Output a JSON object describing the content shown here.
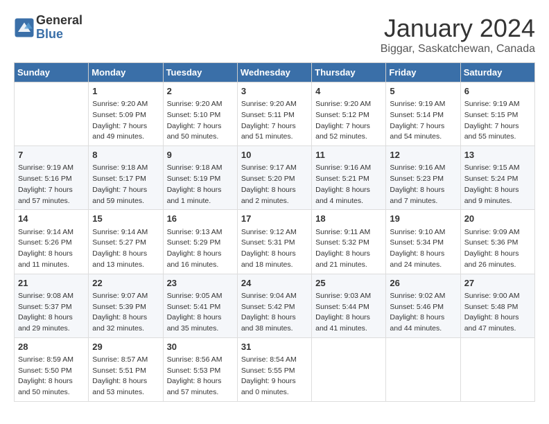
{
  "logo": {
    "general": "General",
    "blue": "Blue"
  },
  "header": {
    "month": "January 2024",
    "location": "Biggar, Saskatchewan, Canada"
  },
  "weekdays": [
    "Sunday",
    "Monday",
    "Tuesday",
    "Wednesday",
    "Thursday",
    "Friday",
    "Saturday"
  ],
  "weeks": [
    [
      {
        "day": "",
        "info": ""
      },
      {
        "day": "1",
        "info": "Sunrise: 9:20 AM\nSunset: 5:09 PM\nDaylight: 7 hours\nand 49 minutes."
      },
      {
        "day": "2",
        "info": "Sunrise: 9:20 AM\nSunset: 5:10 PM\nDaylight: 7 hours\nand 50 minutes."
      },
      {
        "day": "3",
        "info": "Sunrise: 9:20 AM\nSunset: 5:11 PM\nDaylight: 7 hours\nand 51 minutes."
      },
      {
        "day": "4",
        "info": "Sunrise: 9:20 AM\nSunset: 5:12 PM\nDaylight: 7 hours\nand 52 minutes."
      },
      {
        "day": "5",
        "info": "Sunrise: 9:19 AM\nSunset: 5:14 PM\nDaylight: 7 hours\nand 54 minutes."
      },
      {
        "day": "6",
        "info": "Sunrise: 9:19 AM\nSunset: 5:15 PM\nDaylight: 7 hours\nand 55 minutes."
      }
    ],
    [
      {
        "day": "7",
        "info": "Sunrise: 9:19 AM\nSunset: 5:16 PM\nDaylight: 7 hours\nand 57 minutes."
      },
      {
        "day": "8",
        "info": "Sunrise: 9:18 AM\nSunset: 5:17 PM\nDaylight: 7 hours\nand 59 minutes."
      },
      {
        "day": "9",
        "info": "Sunrise: 9:18 AM\nSunset: 5:19 PM\nDaylight: 8 hours\nand 1 minute."
      },
      {
        "day": "10",
        "info": "Sunrise: 9:17 AM\nSunset: 5:20 PM\nDaylight: 8 hours\nand 2 minutes."
      },
      {
        "day": "11",
        "info": "Sunrise: 9:16 AM\nSunset: 5:21 PM\nDaylight: 8 hours\nand 4 minutes."
      },
      {
        "day": "12",
        "info": "Sunrise: 9:16 AM\nSunset: 5:23 PM\nDaylight: 8 hours\nand 7 minutes."
      },
      {
        "day": "13",
        "info": "Sunrise: 9:15 AM\nSunset: 5:24 PM\nDaylight: 8 hours\nand 9 minutes."
      }
    ],
    [
      {
        "day": "14",
        "info": "Sunrise: 9:14 AM\nSunset: 5:26 PM\nDaylight: 8 hours\nand 11 minutes."
      },
      {
        "day": "15",
        "info": "Sunrise: 9:14 AM\nSunset: 5:27 PM\nDaylight: 8 hours\nand 13 minutes."
      },
      {
        "day": "16",
        "info": "Sunrise: 9:13 AM\nSunset: 5:29 PM\nDaylight: 8 hours\nand 16 minutes."
      },
      {
        "day": "17",
        "info": "Sunrise: 9:12 AM\nSunset: 5:31 PM\nDaylight: 8 hours\nand 18 minutes."
      },
      {
        "day": "18",
        "info": "Sunrise: 9:11 AM\nSunset: 5:32 PM\nDaylight: 8 hours\nand 21 minutes."
      },
      {
        "day": "19",
        "info": "Sunrise: 9:10 AM\nSunset: 5:34 PM\nDaylight: 8 hours\nand 24 minutes."
      },
      {
        "day": "20",
        "info": "Sunrise: 9:09 AM\nSunset: 5:36 PM\nDaylight: 8 hours\nand 26 minutes."
      }
    ],
    [
      {
        "day": "21",
        "info": "Sunrise: 9:08 AM\nSunset: 5:37 PM\nDaylight: 8 hours\nand 29 minutes."
      },
      {
        "day": "22",
        "info": "Sunrise: 9:07 AM\nSunset: 5:39 PM\nDaylight: 8 hours\nand 32 minutes."
      },
      {
        "day": "23",
        "info": "Sunrise: 9:05 AM\nSunset: 5:41 PM\nDaylight: 8 hours\nand 35 minutes."
      },
      {
        "day": "24",
        "info": "Sunrise: 9:04 AM\nSunset: 5:42 PM\nDaylight: 8 hours\nand 38 minutes."
      },
      {
        "day": "25",
        "info": "Sunrise: 9:03 AM\nSunset: 5:44 PM\nDaylight: 8 hours\nand 41 minutes."
      },
      {
        "day": "26",
        "info": "Sunrise: 9:02 AM\nSunset: 5:46 PM\nDaylight: 8 hours\nand 44 minutes."
      },
      {
        "day": "27",
        "info": "Sunrise: 9:00 AM\nSunset: 5:48 PM\nDaylight: 8 hours\nand 47 minutes."
      }
    ],
    [
      {
        "day": "28",
        "info": "Sunrise: 8:59 AM\nSunset: 5:50 PM\nDaylight: 8 hours\nand 50 minutes."
      },
      {
        "day": "29",
        "info": "Sunrise: 8:57 AM\nSunset: 5:51 PM\nDaylight: 8 hours\nand 53 minutes."
      },
      {
        "day": "30",
        "info": "Sunrise: 8:56 AM\nSunset: 5:53 PM\nDaylight: 8 hours\nand 57 minutes."
      },
      {
        "day": "31",
        "info": "Sunrise: 8:54 AM\nSunset: 5:55 PM\nDaylight: 9 hours\nand 0 minutes."
      },
      {
        "day": "",
        "info": ""
      },
      {
        "day": "",
        "info": ""
      },
      {
        "day": "",
        "info": ""
      }
    ]
  ]
}
